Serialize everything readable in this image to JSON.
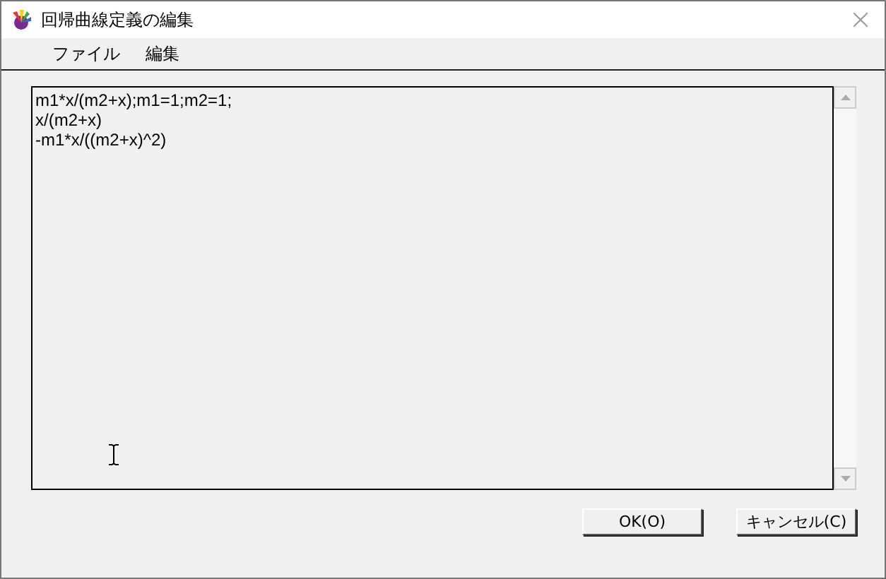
{
  "window": {
    "title": "回帰曲線定義の編集"
  },
  "menu": [
    "ファイル",
    "編集"
  ],
  "editor": {
    "lines": [
      "m1*x/(m2+x);m1=1;m2=1;",
      "x/(m2+x)",
      "-m1*x/((m2+x)^2)"
    ]
  },
  "buttons": [
    "OK(O)",
    "キャンセル(C)"
  ]
}
